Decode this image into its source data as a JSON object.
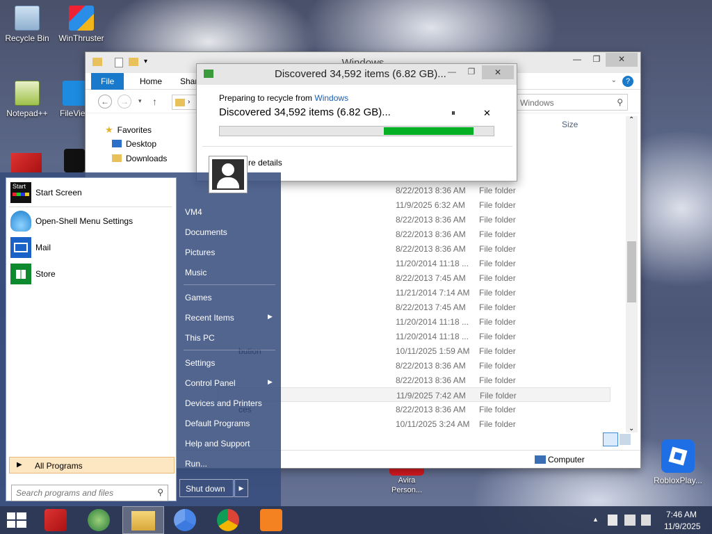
{
  "desktop": {
    "icons": [
      {
        "label": "Recycle Bin"
      },
      {
        "label": "WinThruster"
      },
      {
        "label": "Notepad++"
      },
      {
        "label": "FileVie"
      },
      {
        "label": "Avira Person..."
      },
      {
        "label": "RobloxPlay..."
      }
    ]
  },
  "explorer": {
    "title": "Windows",
    "tabs": {
      "file": "File",
      "home": "Home",
      "share": "Shar"
    },
    "search_placeholder": "Windows",
    "column_size": "Size",
    "nav": {
      "favorites": "Favorites",
      "desktop": "Desktop",
      "downloads": "Downloads"
    },
    "rows": [
      {
        "name": "",
        "date": "8/22/2013 8:36 AM",
        "type": "File folder"
      },
      {
        "name": "",
        "date": "11/9/2025 6:32 AM",
        "type": "File folder"
      },
      {
        "name": "",
        "date": "8/22/2013 8:36 AM",
        "type": "File folder"
      },
      {
        "name": "",
        "date": "8/22/2013 8:36 AM",
        "type": "File folder"
      },
      {
        "name": "",
        "date": "8/22/2013 8:36 AM",
        "type": "File folder"
      },
      {
        "name": "",
        "date": "11/20/2014 11:18 ...",
        "type": "File folder"
      },
      {
        "name": "",
        "date": "8/22/2013 7:45 AM",
        "type": "File folder"
      },
      {
        "name": "",
        "date": "11/21/2014 7:14 AM",
        "type": "File folder"
      },
      {
        "name": "",
        "date": "8/22/2013 7:45 AM",
        "type": "File folder"
      },
      {
        "name": "",
        "date": "11/20/2014 11:18 ...",
        "type": "File folder"
      },
      {
        "name": "",
        "date": "11/20/2014 11:18 ...",
        "type": "File folder"
      },
      {
        "name": "bution",
        "date": "10/11/2025 1:59 AM",
        "type": "File folder"
      },
      {
        "name": "",
        "date": "8/22/2013 8:36 AM",
        "type": "File folder"
      },
      {
        "name": "",
        "date": "8/22/2013 8:36 AM",
        "type": "File folder"
      },
      {
        "name": "",
        "date": "11/9/2025 7:42 AM",
        "type": "File folder"
      },
      {
        "name": "ces",
        "date": "8/22/2013 8:36 AM",
        "type": "File folder"
      },
      {
        "name": "",
        "date": "10/11/2025 3:24 AM",
        "type": "File folder"
      }
    ],
    "status_location": "Computer"
  },
  "dialog": {
    "title": "Discovered 34,592 items (6.82 GB)...",
    "preparing_prefix": "Preparing to recycle from ",
    "preparing_link": "Windows",
    "heading": "Discovered 34,592 items (6.82 GB)...",
    "progress": {
      "start": 0.6,
      "end": 0.927
    },
    "more_details": "re details",
    "pause_glyph": "⏸",
    "close_glyph": "✕"
  },
  "startmenu": {
    "left_items": [
      {
        "label": "Start Screen",
        "icon": "start-screen-icon"
      },
      {
        "label": "Open-Shell Menu Settings",
        "icon": "shell-icon"
      },
      {
        "label": "Mail",
        "icon": "mail-icon"
      },
      {
        "label": "Store",
        "icon": "store-icon"
      }
    ],
    "start_icon_text": "Start",
    "all_programs": "All Programs",
    "search_placeholder": "Search programs and files",
    "right_items": [
      {
        "label": "VM4"
      },
      {
        "label": "Documents"
      },
      {
        "label": "Pictures"
      },
      {
        "label": "Music"
      },
      {
        "label": "Games"
      },
      {
        "label": "Recent Items"
      },
      {
        "label": "This PC"
      },
      {
        "label": "Settings"
      },
      {
        "label": "Control Panel"
      },
      {
        "label": "Devices and Printers"
      },
      {
        "label": "Default Programs"
      },
      {
        "label": "Help and Support"
      },
      {
        "label": "Run..."
      }
    ],
    "shutdown": "Shut down"
  },
  "taskbar": {
    "time": "7:46 AM",
    "date": "11/9/2025"
  },
  "colors": {
    "accent": "#1979ca",
    "progress": "#06b025",
    "all_programs_bg": "#fde6c2"
  }
}
